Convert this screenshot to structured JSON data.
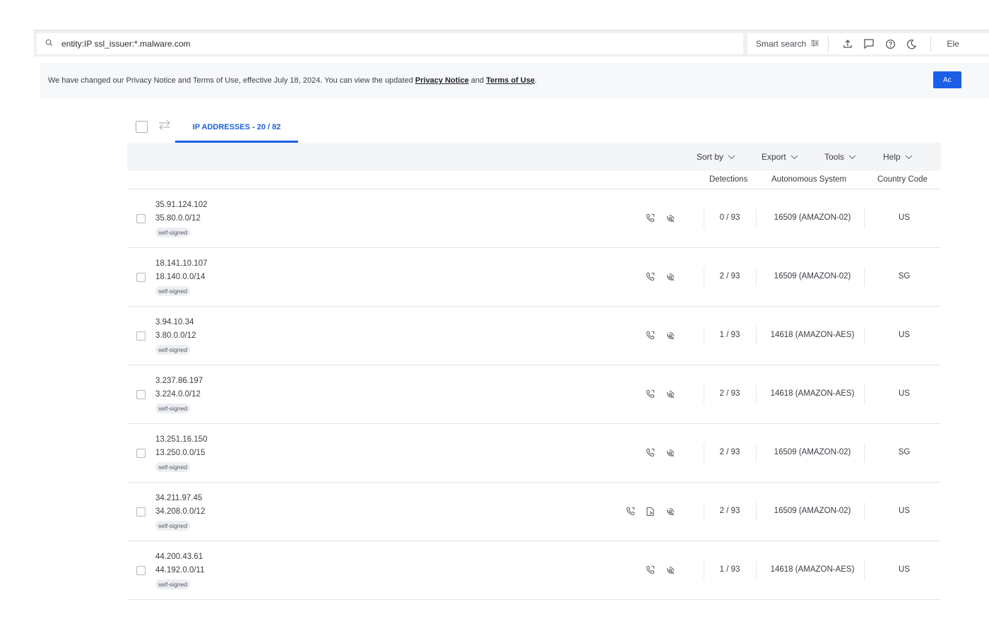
{
  "search": {
    "query": "entity:IP ssl_issuer:*.malware.com",
    "smart_search_label": "Smart search",
    "user_label": "Ele"
  },
  "banner": {
    "text_before": "We have changed our Privacy Notice and Terms of Use, effective July 18, 2024. You can view the updated ",
    "privacy_link": "Privacy Notice",
    "text_and": " and ",
    "terms_link": "Terms of Use",
    "text_after": ".",
    "accept_label": "Ac"
  },
  "tabs": {
    "ip_addresses": "IP ADDRESSES - 20 / 82"
  },
  "toolbar": {
    "sort_by": "Sort by",
    "export": "Export",
    "tools": "Tools",
    "help": "Help"
  },
  "columns": {
    "detections": "Detections",
    "autonomous_system": "Autonomous System",
    "country_code": "Country Code"
  },
  "rows": [
    {
      "ip": "35.91.124.102",
      "network": "35.80.0.0/12",
      "tag": "self-signed",
      "detections": "0 / 93",
      "as": "16509 (AMAZON-02)",
      "country": "US",
      "icons": [
        "phone-icon",
        "satellite-icon"
      ]
    },
    {
      "ip": "18.141.10.107",
      "network": "18.140.0.0/14",
      "tag": "self-signed",
      "detections": "2 / 93",
      "as": "16509 (AMAZON-02)",
      "country": "SG",
      "icons": [
        "phone-icon",
        "satellite-icon"
      ]
    },
    {
      "ip": "3.94.10.34",
      "network": "3.80.0.0/12",
      "tag": "self-signed",
      "detections": "1 / 93",
      "as": "14618 (AMAZON-AES)",
      "country": "US",
      "icons": [
        "phone-icon",
        "satellite-icon"
      ]
    },
    {
      "ip": "3.237.86.197",
      "network": "3.224.0.0/12",
      "tag": "self-signed",
      "detections": "2 / 93",
      "as": "14618 (AMAZON-AES)",
      "country": "US",
      "icons": [
        "phone-icon",
        "satellite-icon"
      ]
    },
    {
      "ip": "13.251.16.150",
      "network": "13.250.0.0/15",
      "tag": "self-signed",
      "detections": "2 / 93",
      "as": "16509 (AMAZON-02)",
      "country": "SG",
      "icons": [
        "phone-icon",
        "satellite-icon"
      ]
    },
    {
      "ip": "34.211.97.45",
      "network": "34.208.0.0/12",
      "tag": "self-signed",
      "detections": "2 / 93",
      "as": "16509 (AMAZON-02)",
      "country": "US",
      "icons": [
        "phone-icon",
        "file-arrow-icon",
        "satellite-icon"
      ]
    },
    {
      "ip": "44.200.43.61",
      "network": "44.192.0.0/11",
      "tag": "self-signed",
      "detections": "1 / 93",
      "as": "14618 (AMAZON-AES)",
      "country": "US",
      "icons": [
        "phone-icon",
        "satellite-icon"
      ]
    }
  ],
  "colors": {
    "accent": "#1b5fe6",
    "banner_bg": "#f7f8fa",
    "toolbar_bg": "#f4f5f7"
  }
}
